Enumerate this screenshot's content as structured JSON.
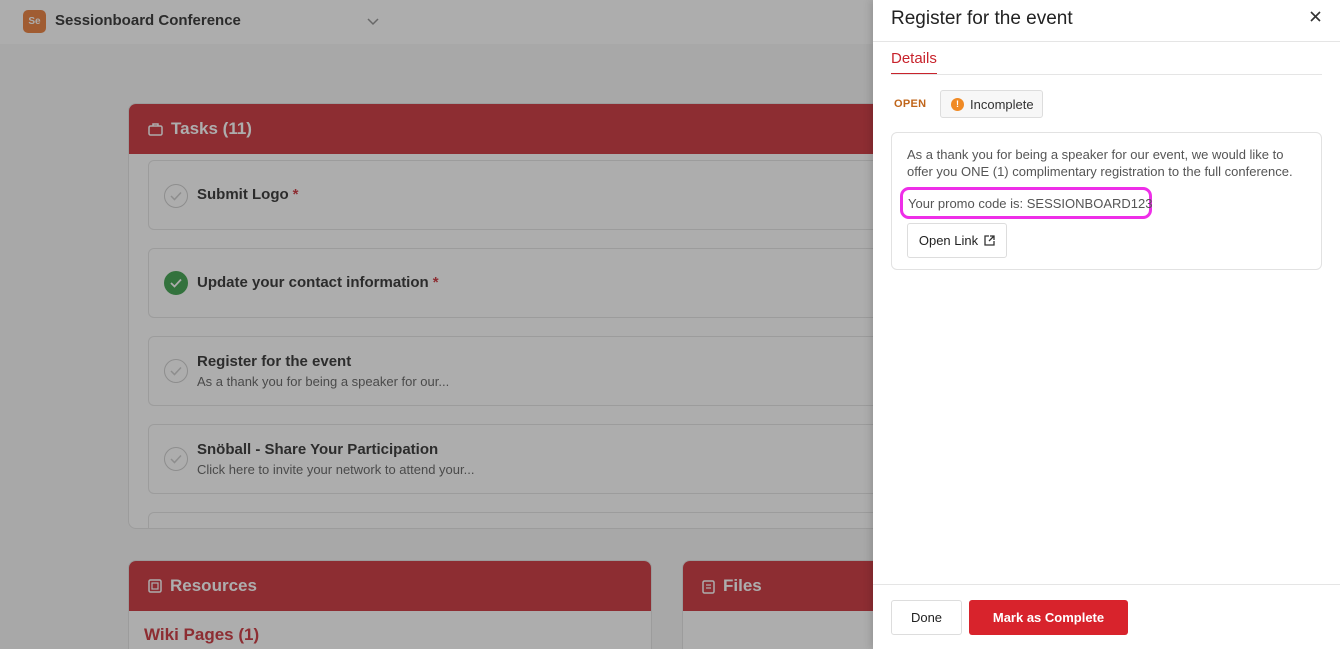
{
  "app": {
    "logo_text": "Se",
    "title": "Sessionboard Conference"
  },
  "tasks": {
    "heading": "Tasks (11)",
    "items": [
      {
        "title": "Submit Logo",
        "required": "*",
        "subtitle": "",
        "done": false
      },
      {
        "title": "Update your contact information",
        "required": "*",
        "subtitle": "",
        "done": true
      },
      {
        "title": "Register for the event",
        "required": "",
        "subtitle": "As a thank you for being a speaker for our...",
        "done": false
      },
      {
        "title": "Snöball - Share Your Participation",
        "required": "",
        "subtitle": "Click here to invite your network to attend your...",
        "done": false
      }
    ]
  },
  "resources": {
    "heading": "Resources",
    "wiki_pages": "Wiki Pages (1)"
  },
  "files": {
    "heading": "Files"
  },
  "drawer": {
    "title": "Register for the event",
    "tab_details": "Details",
    "status": "OPEN",
    "badge_label": "Incomplete",
    "badge_icon_text": "!",
    "description": "As a thank you for being a speaker for our event, we would like to offer you ONE (1) complimentary registration to the full conference.",
    "promo_text": "Your promo code is: SESSIONBOARD123",
    "open_link_label": "Open Link",
    "done_label": "Done",
    "complete_label": "Mark as Complete"
  },
  "colors": {
    "brand_red": "#c8232c",
    "highlight_magenta": "#ee2ee8",
    "warning_orange": "#f08a24",
    "success_green": "#2e9a3f"
  }
}
